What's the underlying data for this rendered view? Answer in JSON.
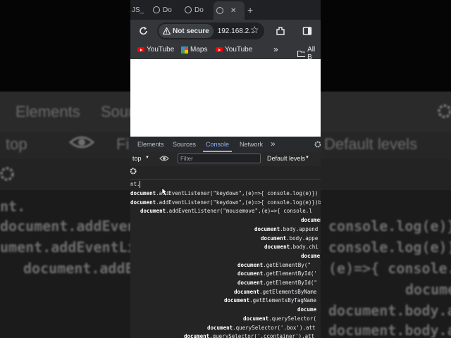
{
  "background": {
    "tab_elements": "Elements",
    "tab_sources": "Sour",
    "context": "top",
    "filter": "Fi",
    "levels": "Default levels",
    "prompt": "nt.",
    "code_lines": [
      "document.addEventLi",
      "ument.addEventLis",
      "document.addEv"
    ],
    "right_lines": [
      "console.log(e)}",
      "console.log(e))",
      "(e)=>{ console.lo",
      "docume",
      "document.body.append",
      "document.body.app"
    ]
  },
  "browser": {
    "tabs": [
      {
        "label": "JS_"
      },
      {
        "label": "Do"
      },
      {
        "label": "Do"
      },
      {
        "label": ""
      }
    ],
    "new_tab": "+",
    "security_label": "Not secure",
    "url": "192.168.2...",
    "bookmarks": [
      {
        "label": "YouTube",
        "icon": "youtube-icon"
      },
      {
        "label": "Maps",
        "icon": "maps-icon"
      },
      {
        "label": "YouTube",
        "icon": "youtube-icon"
      }
    ],
    "bookmarks_overflow": "»",
    "all_bookmarks": "All B"
  },
  "devtools": {
    "tabs": [
      "Elements",
      "Sources",
      "Console",
      "Network"
    ],
    "active_tab": "Console",
    "more": "»",
    "context": "top",
    "filter_placeholder": "Filter",
    "levels": "Default levels",
    "prompt_text": "nt.",
    "autocomplete": [
      {
        "kw": "document",
        "rest": ".addEventListener(\"keydown\",(e)=>{ console.log(e)})"
      },
      {
        "kw": "document",
        "rest": ".addEventListener(\"keydown\",(e)=>{ console.log(e)})b"
      },
      {
        "kw": "document",
        "rest": ".addEventListener(\"mousemove\",(e)=>{ console.l"
      },
      {
        "kw": "document",
        "rest": ""
      },
      {
        "kw": "document",
        "rest": ".body.append"
      },
      {
        "kw": "document",
        "rest": ".body.appe"
      },
      {
        "kw": "document",
        "rest": ".body.chi"
      },
      {
        "kw": "docume",
        "rest": ""
      },
      {
        "kw": "document",
        "rest": ".getElementBy(\""
      },
      {
        "kw": "document",
        "rest": ".getElementById('"
      },
      {
        "kw": "document",
        "rest": ".getElementById(\""
      },
      {
        "kw": "document",
        "rest": ".getElementsByName"
      },
      {
        "kw": "document",
        "rest": ".getElementsByTagName"
      },
      {
        "kw": "docume",
        "rest": ""
      },
      {
        "kw": "document",
        "rest": ".querySelector("
      },
      {
        "kw": "document",
        "rest": ".querySelector('.box').att"
      },
      {
        "kw": "document",
        "rest": ".querySelector('.ccontainer').att"
      }
    ]
  },
  "colors": {
    "accent": "#8ab4f8",
    "warning": "#e8eaed",
    "youtube": "#ff0000"
  }
}
